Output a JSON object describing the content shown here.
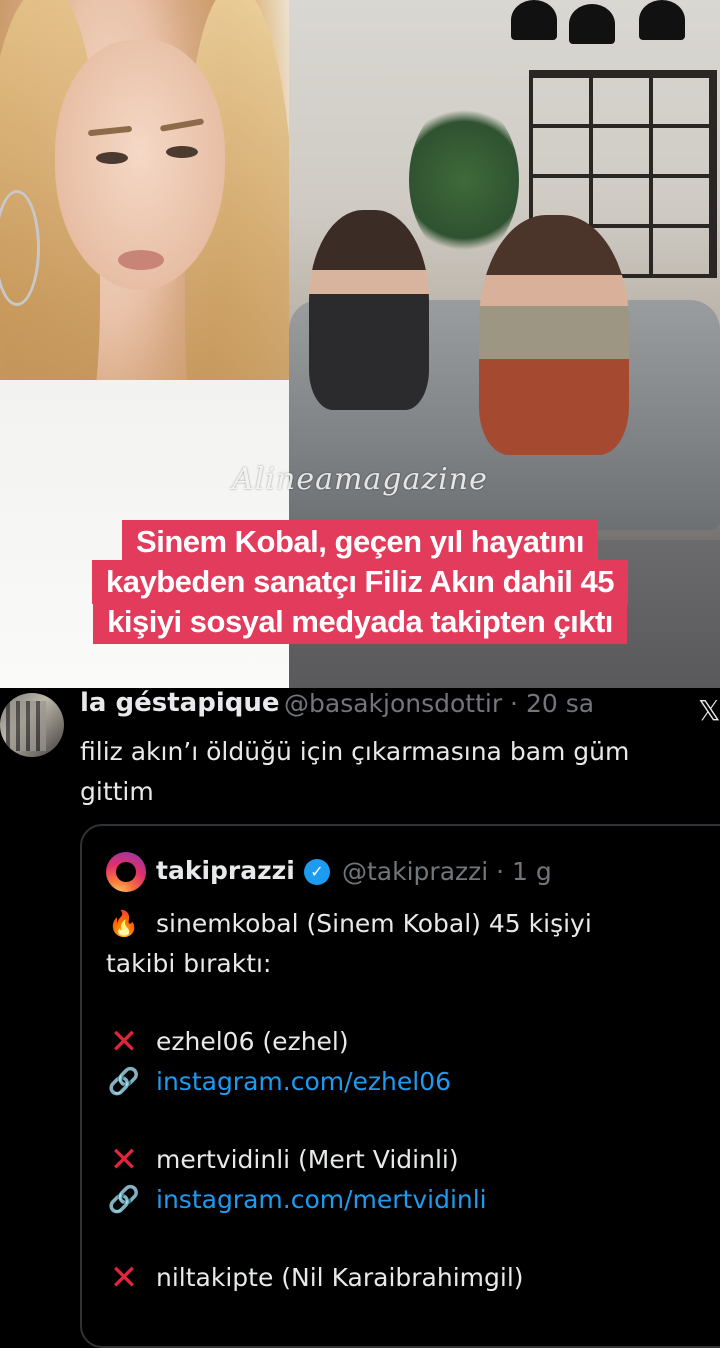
{
  "image": {
    "watermark": "Alineamagazine",
    "headline": [
      "Sinem Kobal, geçen yıl hayatını",
      "kaybeden sanatçı Filiz Akın dahil 45",
      "kişiyi sosyal medyada takipten çıktı"
    ],
    "headline_color": "#e23b5c"
  },
  "tweet": {
    "author_name": "la géstapique",
    "author_handle": "@basakjonsdottir · 20 sa",
    "text_line1": "filiz akın’ı öldüğü için çıkarmasına bam güm",
    "text_line2": "gittim",
    "quote": {
      "author_name": "takiprazzi",
      "author_handle": "@takiprazzi · 1 g",
      "intro_line1": "sinemkobal (Sinem Kobal) 45 kişiyi",
      "intro_line2": "takibi bıraktı:",
      "entries": [
        {
          "name": "ezhel06 (ezhel)",
          "link": "instagram.com/ezhel06"
        },
        {
          "name": "mertvidinli (Mert Vidinli)",
          "link": "instagram.com/mertvidinli"
        },
        {
          "name": "niltakipte (Nil Karaibrahimgil)"
        }
      ]
    }
  },
  "icons": {
    "close": "x-logo-icon",
    "fire": "fire-icon",
    "cross": "cross-mark-icon",
    "chain": "link-icon",
    "verified": "verified-badge-icon"
  },
  "colors": {
    "link": "#1d9bf0",
    "verified": "#1d9bf0",
    "secondary_text": "#71767b"
  }
}
